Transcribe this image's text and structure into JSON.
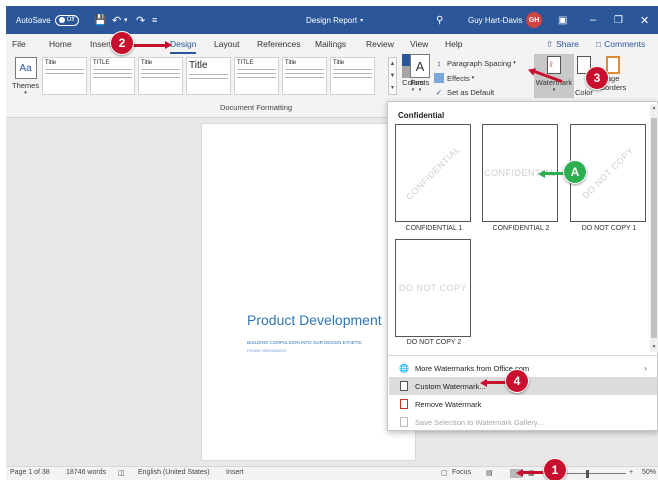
{
  "titlebar": {
    "autosave_label": "AutoSave",
    "autosave_state": "Off",
    "doc_title": "Design Report",
    "user_name": "Guy Hart-Davis",
    "user_initials": "GH"
  },
  "tabs": [
    "File",
    "Home",
    "Insert",
    "Design",
    "Layout",
    "References",
    "Mailings",
    "Review",
    "View",
    "Help"
  ],
  "active_tab": "Design",
  "share_label": "Share",
  "comments_label": "Comments",
  "ribbon": {
    "themes_label": "Themes",
    "gallery_titles": [
      "Title",
      "TITLE",
      "Title",
      "Title",
      "TITLE",
      "Title",
      "Title",
      "Title"
    ],
    "colors_label": "Colors",
    "fonts_label": "Fonts",
    "paragraph_spacing_label": "Paragraph Spacing",
    "effects_label": "Effects",
    "set_default_label": "Set as Default",
    "watermark_label": "Watermark",
    "page_color_label": "Color",
    "page_borders_label": "Borders",
    "page_prefix": "age",
    "group_label": "Document Formatting"
  },
  "document": {
    "title": "Product Development",
    "subtitle": "BUILDING COMPULSION INTO OUR DESIGN ETHETIC",
    "author": "FRANK HERNANDEZ"
  },
  "watermark_menu": {
    "header": "Confidential",
    "items": [
      {
        "label": "CONFIDENTIAL 1",
        "text": "CONFIDENTIAL"
      },
      {
        "label": "CONFIDENTIAL 2",
        "text": "CONFIDENTIAL"
      },
      {
        "label": "DO NOT COPY 1",
        "text": "DO NOT COPY"
      },
      {
        "label": "DO NOT COPY 2",
        "text": "DO NOT COPY"
      }
    ],
    "more_label": "More Watermarks from Office.com",
    "custom_label": "Custom Watermark...",
    "remove_label": "Remove Watermark",
    "save_label": "Save Selection to Watermark Gallery..."
  },
  "statusbar": {
    "page": "Page 1 of 38",
    "words": "18746 words",
    "language": "English (United States)",
    "mode": "Insert",
    "focus": "Focus",
    "zoom": "50%"
  },
  "callouts": [
    "1",
    "2",
    "3",
    "4",
    "A"
  ],
  "colors": {
    "accent": "#2b579a",
    "callout_red": "#c8102e",
    "callout_green": "#2eaf4f",
    "doc_blue": "#2e75b6"
  }
}
